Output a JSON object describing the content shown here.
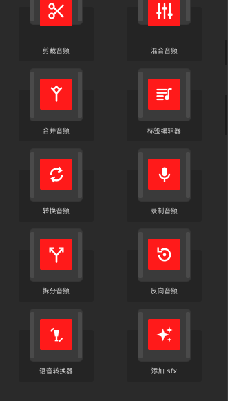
{
  "colors": {
    "background": "#2a2a2a",
    "tile": "#242424",
    "accent": "#ff1a1a",
    "text": "#d8d8d8"
  },
  "tools": [
    {
      "label": "剪裁音频",
      "icon": "scissors-icon"
    },
    {
      "label": "混合音频",
      "icon": "mixer-sliders-icon"
    },
    {
      "label": "合并音频",
      "icon": "merge-arrows-icon"
    },
    {
      "label": "标签编辑器",
      "icon": "playlist-music-icon"
    },
    {
      "label": "转换音频",
      "icon": "convert-arrows-icon"
    },
    {
      "label": "录制音频",
      "icon": "microphone-icon"
    },
    {
      "label": "拆分音频",
      "icon": "split-arrows-icon"
    },
    {
      "label": "反向音频",
      "icon": "reverse-replay-icon"
    },
    {
      "label": "语音转换器",
      "icon": "voice-changer-icon"
    },
    {
      "label": "添加 sfx",
      "icon": "sparkles-icon"
    }
  ]
}
